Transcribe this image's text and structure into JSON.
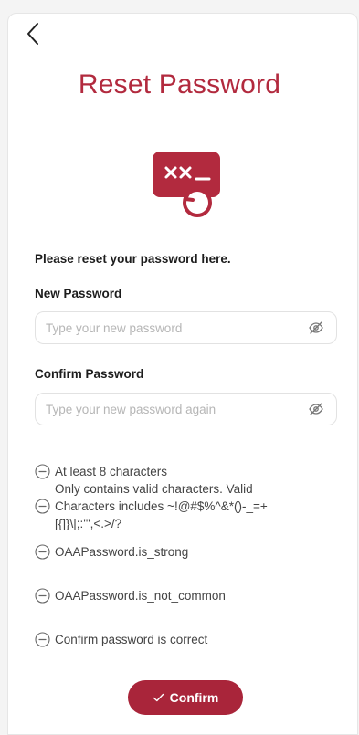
{
  "header": {
    "back_icon": "chevron-left-icon",
    "title": "Reset Password",
    "title_color": "#b22a3e"
  },
  "hero": {
    "icon": "password-reset-icon",
    "icon_color": "#b22a3e"
  },
  "form": {
    "intro": "Please reset your password here.",
    "new_password": {
      "label": "New Password",
      "placeholder": "Type your new password",
      "value": "",
      "toggle_icon": "eye-slash-icon"
    },
    "confirm_password": {
      "label": "Confirm Password",
      "placeholder": "Type your new password again",
      "value": "",
      "toggle_icon": "eye-slash-icon"
    }
  },
  "rules": {
    "status_icon": "minus-circle-icon",
    "items": [
      {
        "text": "At least 8 characters"
      },
      {
        "text": "Only contains valid characters. Valid"
      },
      {
        "text": "Characters includes ~!@#$%^&*()-_=+"
      },
      {
        "text": "[{]}\\|;:'\",<.>/?"
      },
      {
        "text": "OAAPassword.is_strong"
      },
      {
        "text": "OAAPassword.is_not_common"
      },
      {
        "text": "Confirm password is correct"
      }
    ]
  },
  "actions": {
    "confirm_label": "Confirm",
    "confirm_icon": "check-icon",
    "confirm_color": "#a9253a"
  }
}
